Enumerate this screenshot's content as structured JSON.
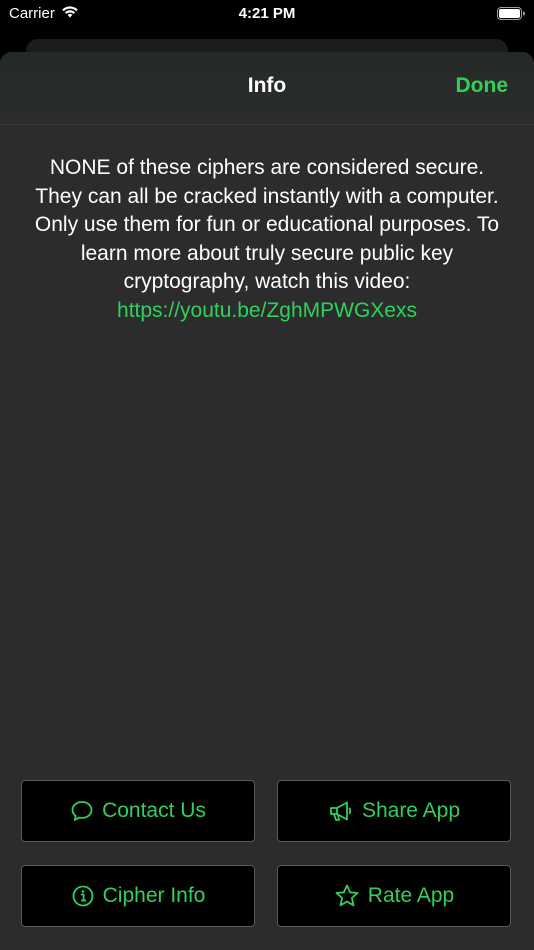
{
  "status_bar": {
    "carrier": "Carrier",
    "time": "4:21 PM",
    "wifi_icon": "wifi-icon",
    "battery_icon": "battery-icon"
  },
  "nav": {
    "title": "Info",
    "done_label": "Done"
  },
  "info": {
    "text": "NONE of these ciphers are considered secure. They can all be cracked instantly with a computer. Only use them for fun or educational purposes. To learn more about truly secure public key cryptography, watch this video:",
    "link": "https://youtu.be/ZghMPWGXexs"
  },
  "buttons": {
    "contact": {
      "label": "Contact Us",
      "icon": "speech-bubble-icon"
    },
    "share": {
      "label": "Share App",
      "icon": "megaphone-icon"
    },
    "cipher_info": {
      "label": "Cipher Info",
      "icon": "info-circle-icon"
    },
    "rate": {
      "label": "Rate App",
      "icon": "star-icon"
    }
  },
  "colors": {
    "accent": "#30d158",
    "sheet_background": "#2c2c2e",
    "button_background": "#000000"
  }
}
